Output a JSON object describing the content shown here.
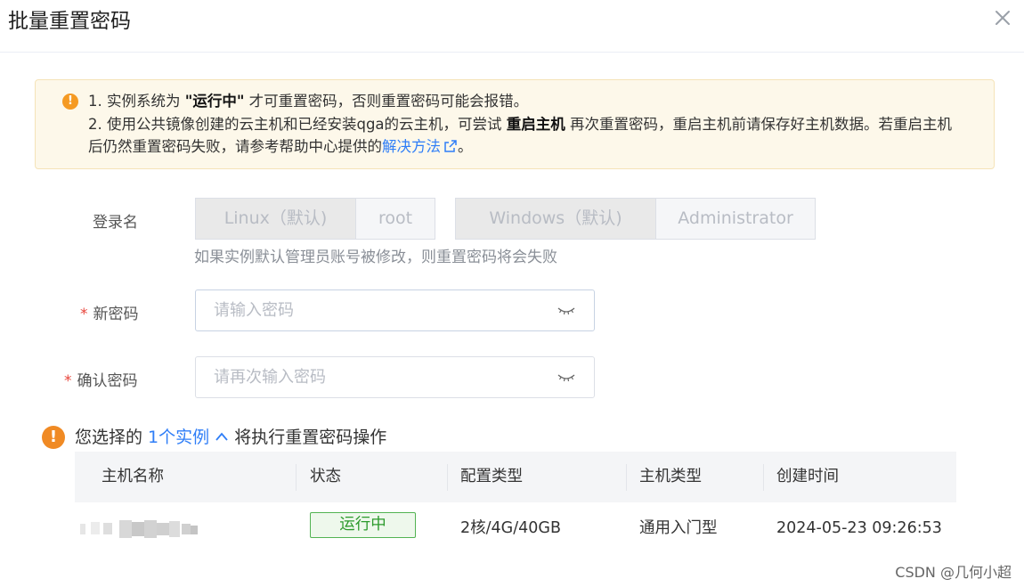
{
  "dialog": {
    "title": "批量重置密码"
  },
  "alert": {
    "line1_prefix": "1. 实例系统为 ",
    "line1_bold": "\"运行中\"",
    "line1_suffix": " 才可重置密码，否则重置密码可能会报错。",
    "line2_prefix": "2. 使用公共镜像创建的云主机和已经安装qga的云主机，可尝试 ",
    "line2_bold": "重启主机",
    "line2_suffix": " 再次重置密码，重启主机前请保存好主机数据。若重启主机后仍然重置密码失败，请参考帮助中心提供的",
    "link_text": "解决方法",
    "line2_end": "。"
  },
  "form": {
    "login_label": "登录名",
    "linux_default": "Linux（默认)",
    "linux_user": "root",
    "windows_default": "Windows（默认)",
    "windows_user": "Administrator",
    "login_hint": "如果实例默认管理员账号被修改，则重置密码将会失败",
    "required_mark": "*",
    "new_password_label": "新密码",
    "new_password_placeholder": "请输入密码",
    "confirm_password_label": "确认密码",
    "confirm_password_placeholder": "请再次输入密码"
  },
  "selection": {
    "prefix": "您选择的 ",
    "count_link": "1个实例",
    "suffix": " 将执行重置密码操作"
  },
  "table": {
    "headers": [
      "主机名称",
      "状态",
      "配置类型",
      "主机类型",
      "创建时间"
    ],
    "rows": [
      {
        "status": "运行中",
        "config": "2核/4G/40GB",
        "host_type": "通用入门型",
        "created": "2024-05-23 09:26:53"
      }
    ]
  },
  "watermark": "CSDN @几何小超",
  "colors": {
    "link": "#2f7ef7",
    "warning": "#f59a23",
    "success": "#52b352",
    "required": "#e8453c"
  }
}
